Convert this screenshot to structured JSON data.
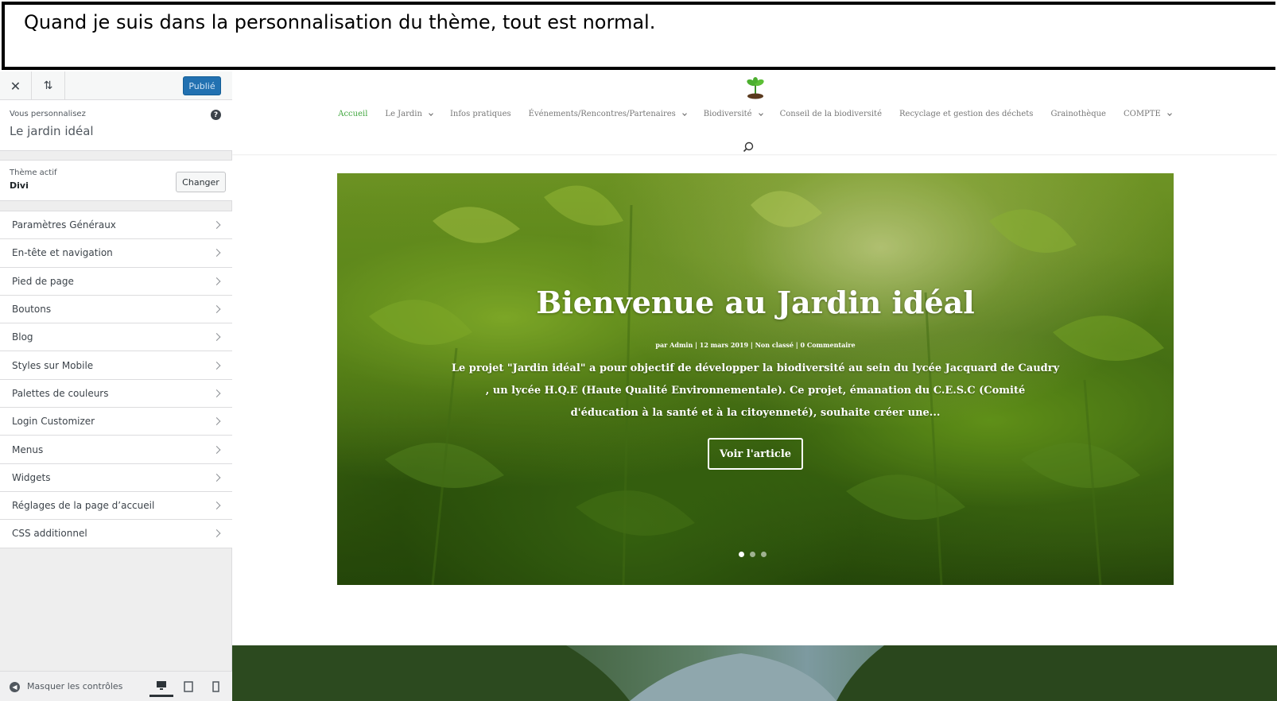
{
  "banner": {
    "text": "Quand je suis dans la personnalisation du thème, tout est normal."
  },
  "customizer": {
    "publish_label": "Publié",
    "info_label": "Vous personnalisez",
    "site_title": "Le jardin idéal",
    "theme_label": "Thème actif",
    "theme_name": "Divi",
    "change_label": "Changer",
    "sections": [
      {
        "label": "Paramètres Généraux"
      },
      {
        "label": "En-tête et navigation"
      },
      {
        "label": "Pied de page"
      },
      {
        "label": "Boutons"
      },
      {
        "label": "Blog"
      },
      {
        "label": "Styles sur Mobile"
      },
      {
        "label": "Palettes de couleurs"
      },
      {
        "label": "Login Customizer"
      },
      {
        "label": "Menus"
      },
      {
        "label": "Widgets"
      },
      {
        "label": "Réglages de la page d’accueil"
      },
      {
        "label": "CSS additionnel"
      }
    ],
    "hide_controls_label": "Masquer les contrôles",
    "accent_color": "#2271b1"
  },
  "site": {
    "nav": [
      {
        "label": "Accueil"
      },
      {
        "label": "Le Jardin"
      },
      {
        "label": "Infos pratiques"
      },
      {
        "label": "Événements/Rencontres/Partenaires"
      },
      {
        "label": "Biodiversité"
      },
      {
        "label": "Conseil de la biodiversité"
      },
      {
        "label": "Recyclage et gestion des déchets"
      },
      {
        "label": "Grainothèque"
      },
      {
        "label": "COMPTE"
      }
    ],
    "nav_active_color": "#40a63e",
    "hero": {
      "title": "Bienvenue au Jardin idéal",
      "meta": "par Admin | 12 mars 2019 | Non classé | 0 Commentaire",
      "excerpt": "Le projet \"Jardin idéal\" a pour objectif de développer la biodiversité au sein du lycée Jacquard de Caudry , un lycée H.Q.E (Haute Qualité Environnementale). Ce projet, émanation du C.E.S.C (Comité d'éducation à la santé et à la citoyenneté), souhaite créer une...",
      "button_label": "Voir l'article",
      "slides_total": 3,
      "active_slide": 1
    }
  }
}
